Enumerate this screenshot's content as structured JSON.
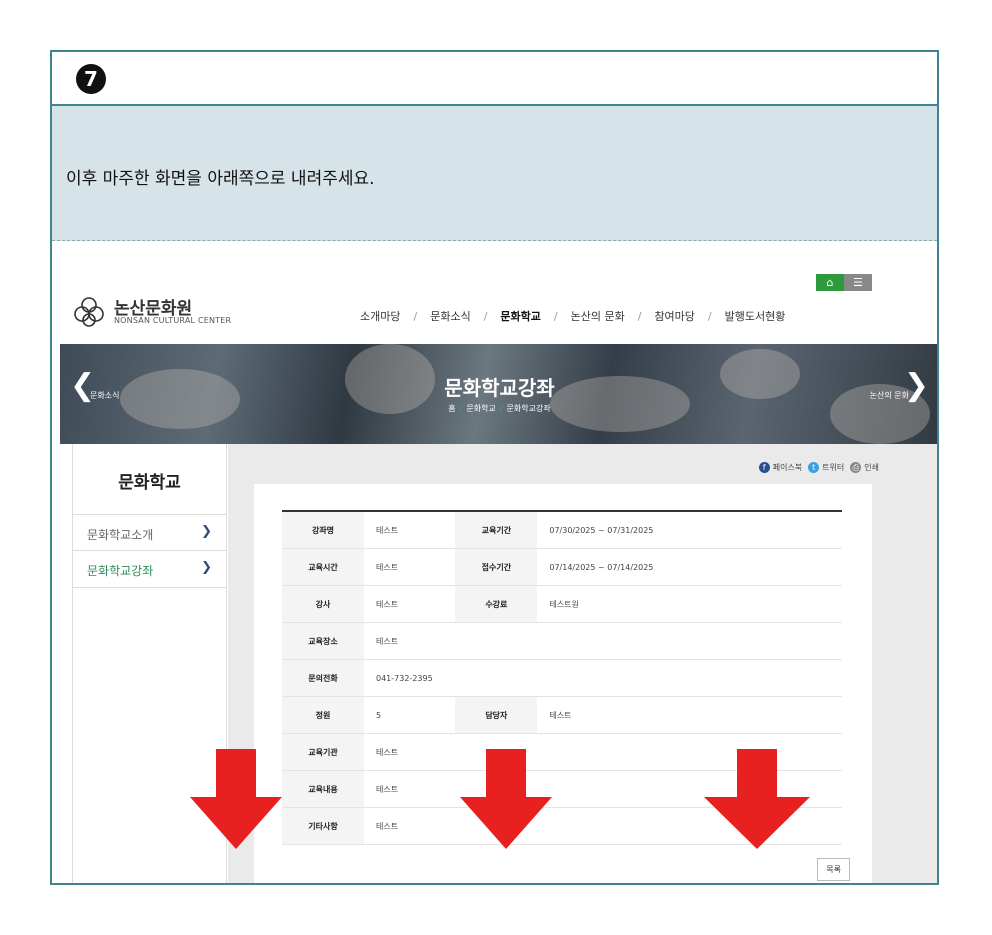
{
  "step": {
    "number": "7"
  },
  "instruction": "이후 마주한 화면을 아래쪽으로 내려주세요.",
  "site": {
    "logo": {
      "name_ko": "논산문화원",
      "name_en": "NONSAN CULTURAL CENTER"
    },
    "util": {
      "home_icon": "home-icon",
      "menu_icon": "menu-icon"
    },
    "gnb": [
      {
        "label": "소개마당",
        "active": false
      },
      {
        "label": "문화소식",
        "active": false
      },
      {
        "label": "문화학교",
        "active": true
      },
      {
        "label": "논산의 문화",
        "active": false
      },
      {
        "label": "참여마당",
        "active": false
      },
      {
        "label": "발행도서현황",
        "active": false
      }
    ],
    "gnb_separator": "/",
    "banner": {
      "title": "문화학교강좌",
      "crumbs": [
        "홈",
        "문화학교",
        "문화학교강좌"
      ],
      "prev_label": "문화소식",
      "next_label": "논산의 문화"
    },
    "lnb": {
      "title": "문화학교",
      "items": [
        {
          "label": "문화학교소개",
          "active": false
        },
        {
          "label": "문화학교강좌",
          "active": true
        }
      ]
    },
    "sns": {
      "facebook": "페이스북",
      "twitter": "트위터",
      "print": "인쇄"
    },
    "table": {
      "row1": {
        "h1": "강좌명",
        "v1": "테스트",
        "h2": "교육기간",
        "v2": "07/30/2025 ~ 07/31/2025"
      },
      "row2": {
        "h1": "교육시간",
        "v1": "테스트",
        "h2": "접수기간",
        "v2": "07/14/2025 ~ 07/14/2025"
      },
      "row3": {
        "h1": "강사",
        "v1": "테스트",
        "h2": "수강료",
        "v2": "테스트원"
      },
      "row4": {
        "h1": "교육장소",
        "v1": "테스트"
      },
      "row5": {
        "h1": "문의전화",
        "v1": "041-732-2395"
      },
      "row6": {
        "h1": "정원",
        "v1": "5",
        "h2": "담당자",
        "v2": "테스트"
      },
      "row7": {
        "h1": "교육기관",
        "v1": "테스트"
      },
      "row8": {
        "h1": "교육내용",
        "v1": "테스트"
      },
      "row9": {
        "h1": "기타사항",
        "v1": "테스트"
      }
    },
    "list_button": "목록"
  },
  "colors": {
    "frame": "#3f8490",
    "instruction_bg": "#d6e3e8",
    "arrow": "#e8201f",
    "green": "#2e9a3e"
  }
}
